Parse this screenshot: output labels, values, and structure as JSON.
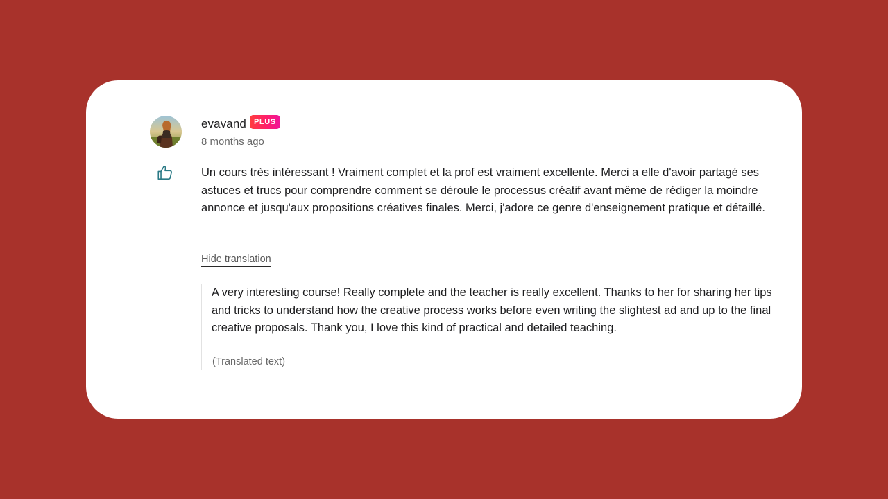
{
  "review": {
    "author": {
      "username": "evavand",
      "badge": "PLUS",
      "avatar_icon": "user-avatar-photo"
    },
    "timestamp": "8 months ago",
    "like_icon": "thumbs-up-icon",
    "original_text": "Un cours très intéressant ! Vraiment complet et la prof est vraiment excellente. Merci a elle d'avoir partagé ses astuces et trucs pour comprendre comment se déroule le processus créatif avant même de rédiger la moindre annonce et jusqu'aux propositions créatives finales. Merci, j'adore ce genre d'enseignement pratique et détaillé.",
    "hide_translation_label": "Hide translation",
    "translated_text": "A very interesting course! Really complete and the teacher is really excellent. Thanks to her for sharing her tips and tricks to understand how the creative process works before even writing the slightest ad and up to the final creative proposals. Thank you, I love this kind of practical and detailed teaching.",
    "translated_note": "(Translated text)"
  },
  "colors": {
    "background": "#a8322b",
    "card": "#ffffff",
    "like_icon": "#2b7a86",
    "badge_gradient_start": "#ff3d3d",
    "badge_gradient_end": "#f0149a"
  }
}
